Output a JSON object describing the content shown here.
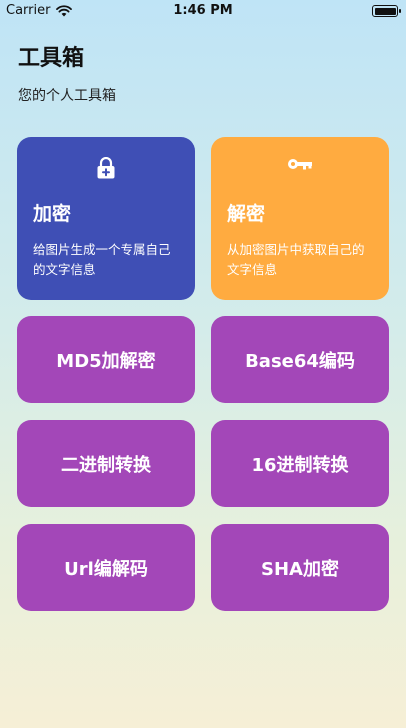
{
  "status": {
    "carrier": "Carrier",
    "time": "1:46 PM"
  },
  "header": {
    "title": "工具箱",
    "subtitle": "您的个人工具箱"
  },
  "cards": {
    "encrypt": {
      "title": "加密",
      "desc": "给图片生成一个专属自己的文字信息",
      "icon": "lock-icon",
      "color": "#3f4fb5"
    },
    "decrypt": {
      "title": "解密",
      "desc": "从加密图片中获取自己的文字信息",
      "icon": "key-icon",
      "color": "#ffab40"
    }
  },
  "tools": [
    {
      "label": "MD5加解密"
    },
    {
      "label": "Base64编码"
    },
    {
      "label": "二进制转换"
    },
    {
      "label": "16进制转换"
    },
    {
      "label": "Url编解码"
    },
    {
      "label": "SHA加密"
    }
  ],
  "colors": {
    "tool_button": "#a347b8"
  }
}
